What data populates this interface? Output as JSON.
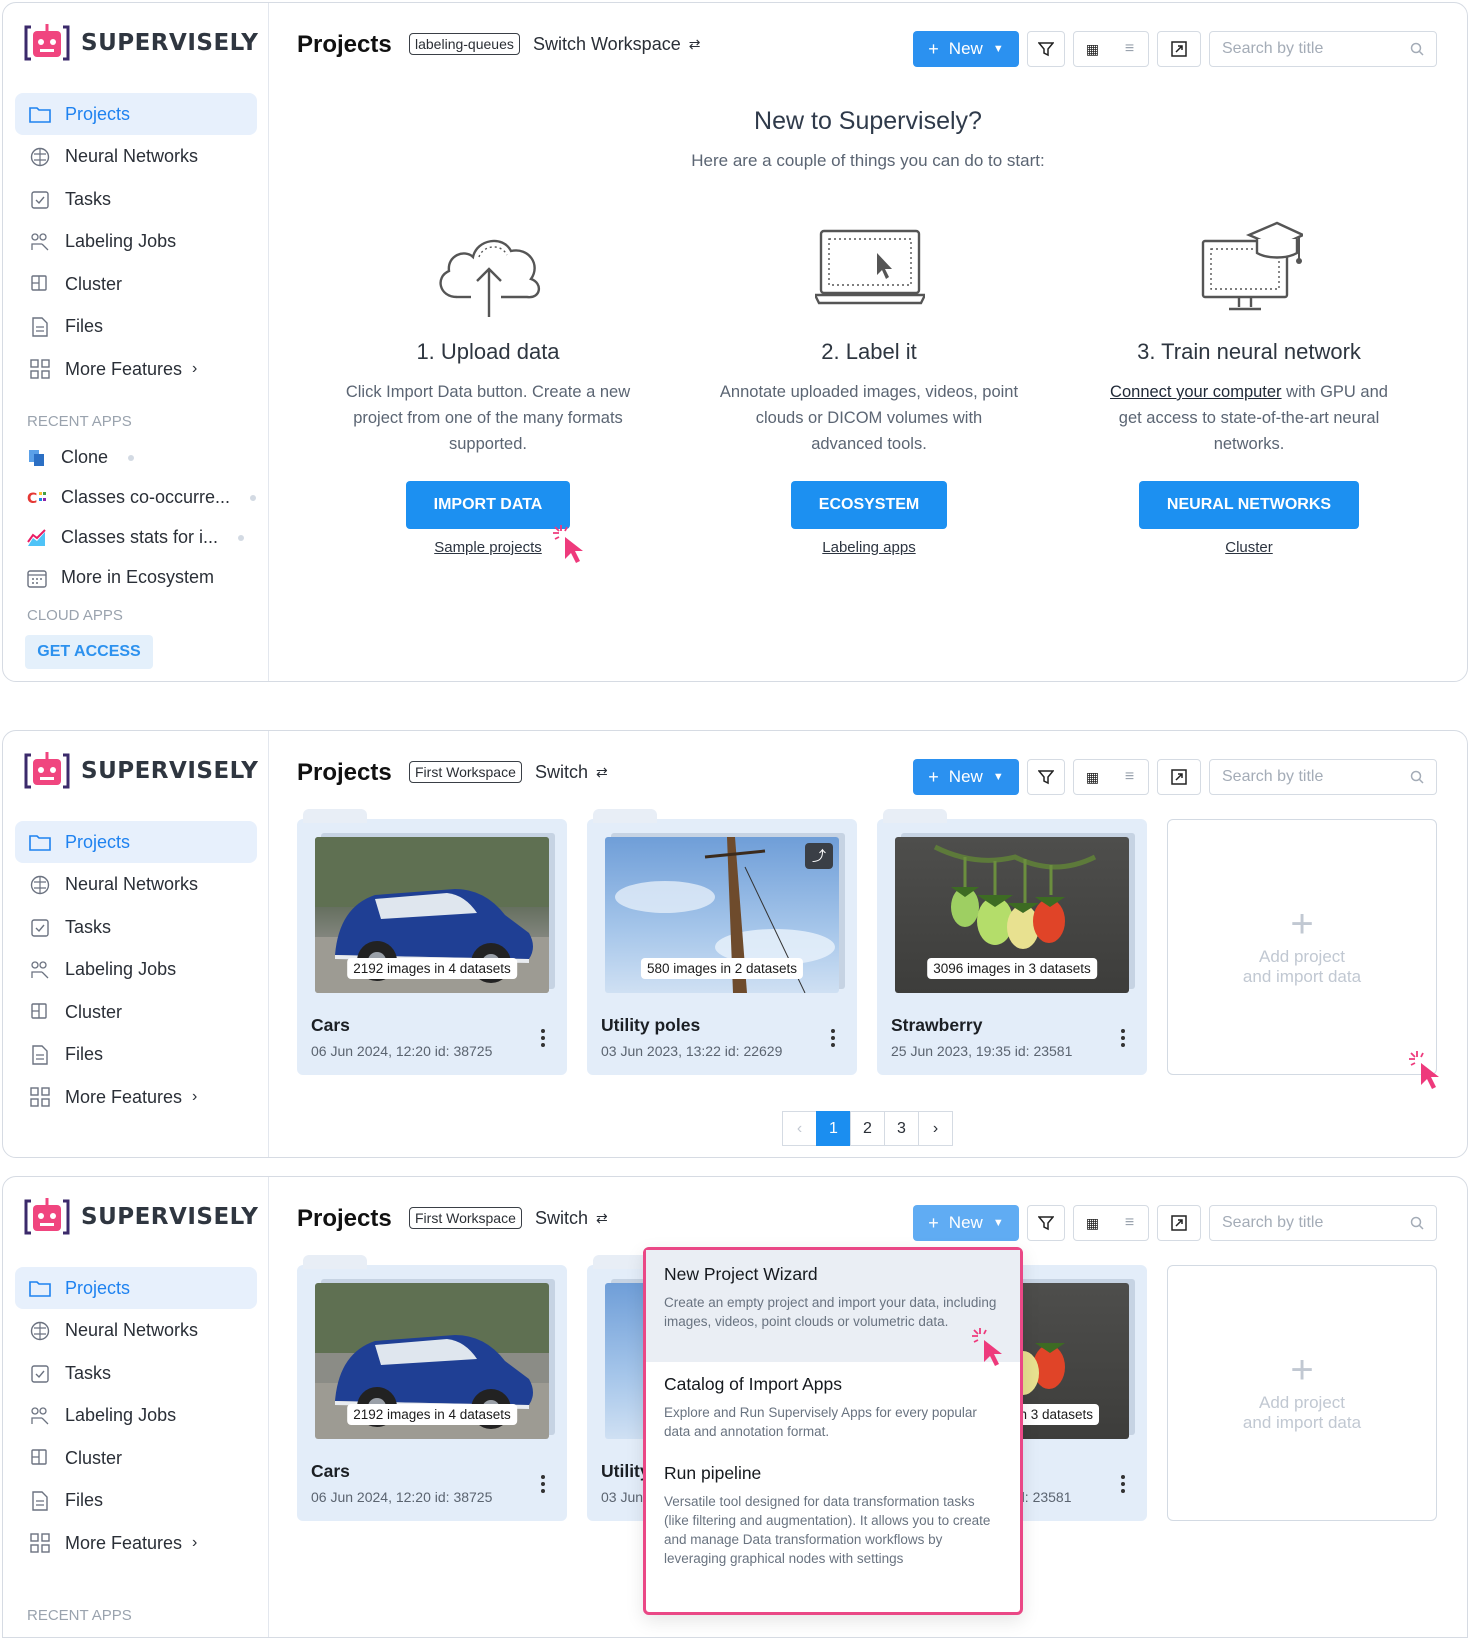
{
  "brand": "SUPERVISELY",
  "colors": {
    "accent": "#2b91f0",
    "cursor": "#ee3a7c",
    "highlight": "#ea4886"
  },
  "sidebar": {
    "items": [
      {
        "label": "Projects",
        "icon": "folder-icon"
      },
      {
        "label": "Neural Networks",
        "icon": "brain-icon"
      },
      {
        "label": "Tasks",
        "icon": "clipboard-icon"
      },
      {
        "label": "Labeling Jobs",
        "icon": "labeling-icon"
      },
      {
        "label": "Cluster",
        "icon": "cluster-icon"
      },
      {
        "label": "Files",
        "icon": "file-icon"
      },
      {
        "label": "More Features",
        "icon": "grid-icon"
      }
    ],
    "recent_apps_label": "RECENT APPS",
    "recent_apps": [
      "Clone",
      "Classes co-occurre...",
      "Classes stats for i...",
      "More in Ecosystem"
    ],
    "cloud_apps_label": "CLOUD APPS",
    "get_access": "GET ACCESS"
  },
  "header": {
    "title": "Projects",
    "new_label": "New",
    "search_placeholder": "Search by title"
  },
  "panel1": {
    "workspace_tag": "labeling-queues",
    "switch_label": "Switch Workspace",
    "welcome_title": "New to Supervisely?",
    "welcome_subtitle": "Here are a couple of things you can do to start:",
    "steps": [
      {
        "title": "1. Upload data",
        "desc": "Click Import Data button. Create a new project from one of the many formats supported.",
        "button": "IMPORT DATA",
        "link": "Sample projects"
      },
      {
        "title": "2. Label it",
        "desc": "Annotate uploaded images, videos, point clouds or DICOM volumes with advanced tools.",
        "button": "ECOSYSTEM",
        "link": "Labeling apps"
      },
      {
        "title": "3. Train neural network",
        "desc_link": "Connect your computer",
        "desc": " with GPU and get access to state-of-the-art neural networks.",
        "button": "NEURAL NETWORKS",
        "link": "Cluster"
      }
    ]
  },
  "panel2": {
    "workspace_tag": "First Workspace",
    "switch_label": "Switch",
    "projects": [
      {
        "name": "Cars",
        "badge": "2192 images in 4 datasets",
        "meta": "06 Jun 2024, 12:20  id: 38725"
      },
      {
        "name": "Utility poles",
        "badge": "580 images in 2 datasets",
        "meta": "03 Jun 2023, 13:22  id: 22629"
      },
      {
        "name": "Strawberry",
        "badge": "3096 images in 3 datasets",
        "meta": "25 Jun 2023, 19:35  id: 23581"
      }
    ],
    "add_project": {
      "line1": "Add project",
      "line2": "and import data"
    },
    "pages": [
      "1",
      "2",
      "3"
    ]
  },
  "panel3": {
    "workspace_tag": "First Workspace",
    "switch_label": "Switch",
    "cars": {
      "name": "Cars",
      "badge": "2192 images in 4 datasets",
      "meta": "06 Jun 2024, 12:20  id: 38725"
    },
    "partial_name": "Utility",
    "partial_meta": "03 Jun",
    "partial_badge": "n 3 datasets",
    "partial_id": "d: 23581",
    "menu": [
      {
        "title": "New Project Wizard",
        "desc": "Create an empty project and import your data, including images, videos, point clouds or volumetric data."
      },
      {
        "title": "Catalog of Import Apps",
        "desc": "Explore and Run Supervisely Apps for every popular data and annotation format."
      },
      {
        "title": "Run pipeline",
        "desc": "Versatile tool designed for data transformation tasks (like filtering and augmentation). It allows you to create and manage Data transformation workflows by leveraging graphical nodes with settings"
      }
    ],
    "recent_apps_label": "RECENT APPS"
  }
}
